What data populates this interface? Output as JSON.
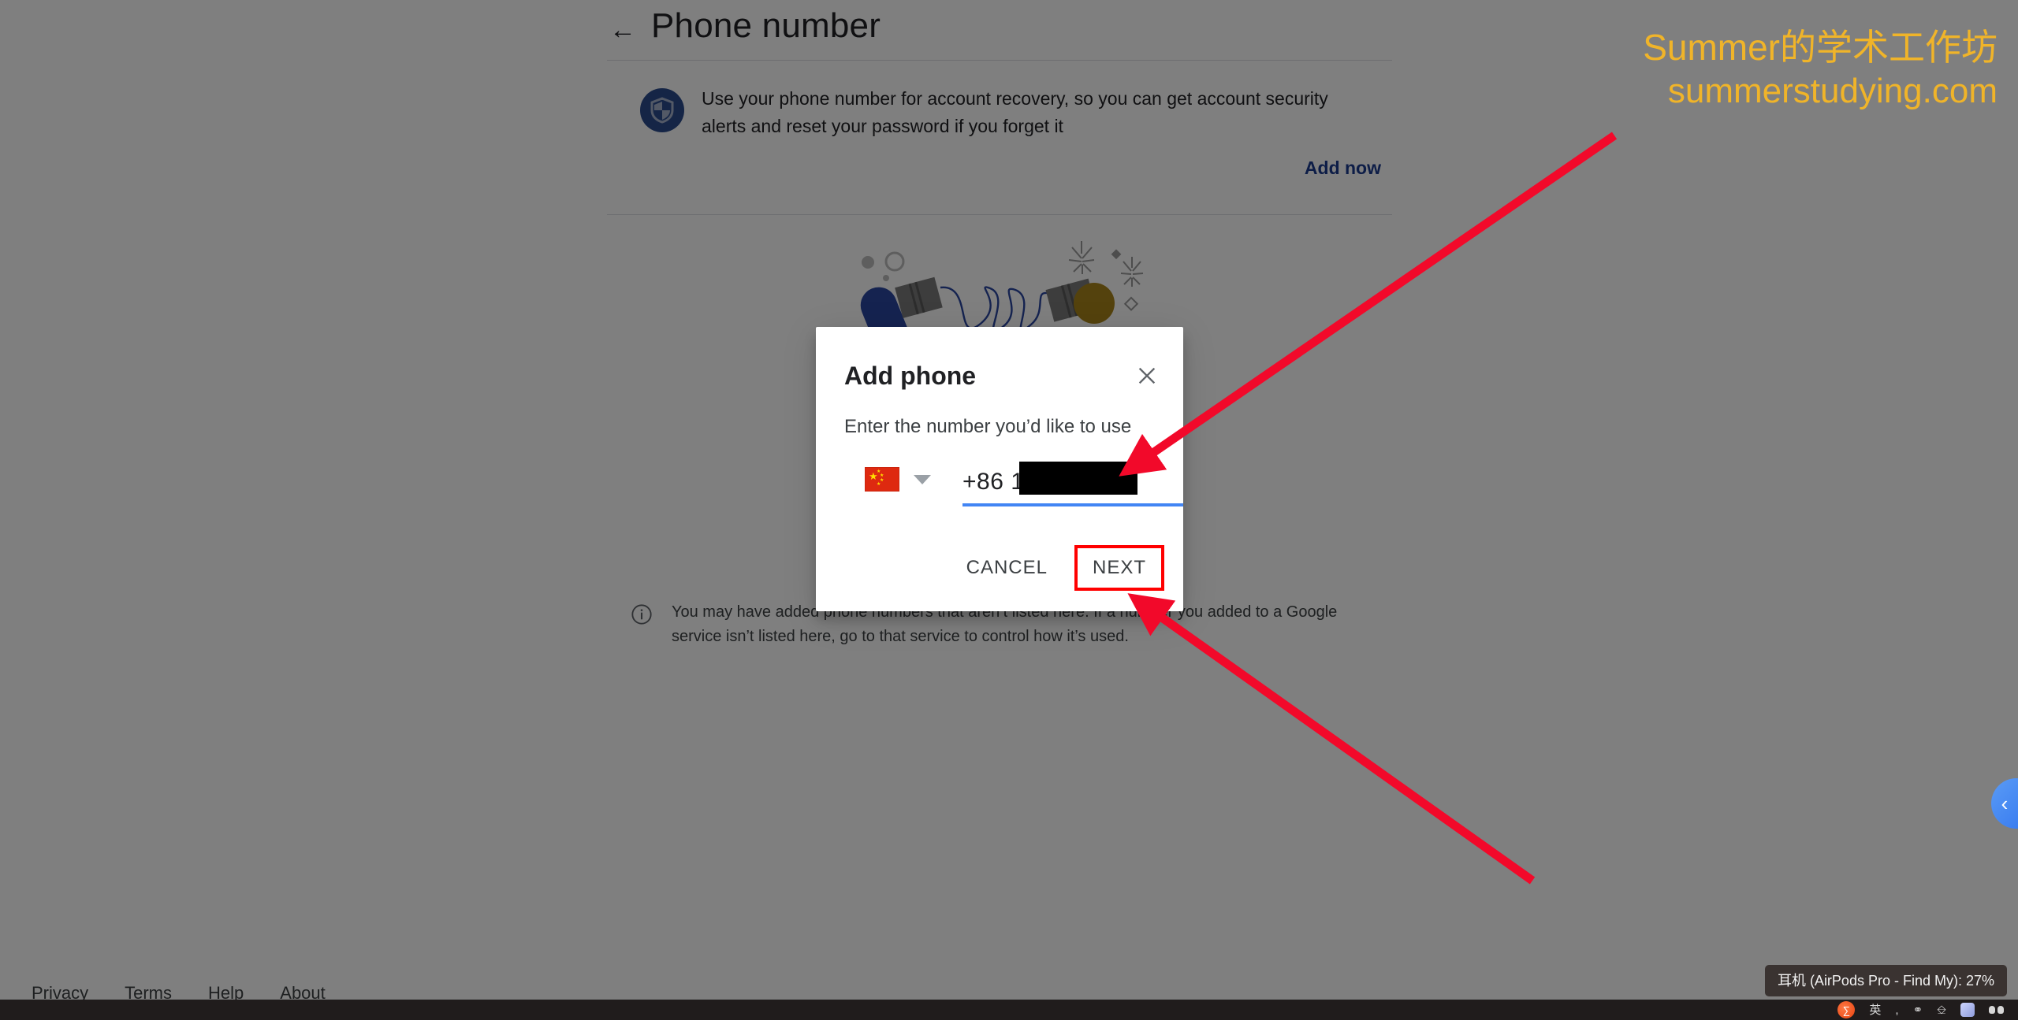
{
  "header": {
    "back_icon": "back-arrow-icon",
    "title": "Phone number"
  },
  "banner": {
    "icon": "shield-icon",
    "text": "Use your phone number for account recovery, so you can get account security alerts and reset your password if you forget it",
    "action_label": "Add now"
  },
  "note": {
    "icon": "info-icon",
    "text": "You may have added phone numbers that aren’t listed here. If a number you added to a Google service isn’t listed here, go to that service to control how it’s used."
  },
  "dialog": {
    "title": "Add phone",
    "close_icon": "close-icon",
    "subtitle": "Enter the number you’d like to use",
    "country": {
      "flag": "china-flag-icon",
      "caret_icon": "chevron-down-icon"
    },
    "phone_value": "+86 19",
    "cancel_label": "CANCEL",
    "next_label": "NEXT"
  },
  "footer": {
    "links": [
      "Privacy",
      "Terms",
      "Help",
      "About"
    ]
  },
  "watermark": {
    "line1": "Summer的学术工作坊",
    "line2": "summerstudying.com",
    "color": "#f0b429"
  },
  "edge_pill": {
    "icon": "chevron-left-icon"
  },
  "taskbar": {
    "tooltip": "耳机 (AirPods Pro - Find My): 27%",
    "tray_icons": [
      "browser-icon",
      "input-method-icon",
      "comma-icon",
      "lightbulb-icon",
      "keyboard-icon",
      "swatch-icon",
      "airpods-icon"
    ]
  },
  "annotations": {
    "highlight_color": "#ff0000",
    "arrow_targets": [
      "phone-number-field",
      "next-button"
    ]
  }
}
